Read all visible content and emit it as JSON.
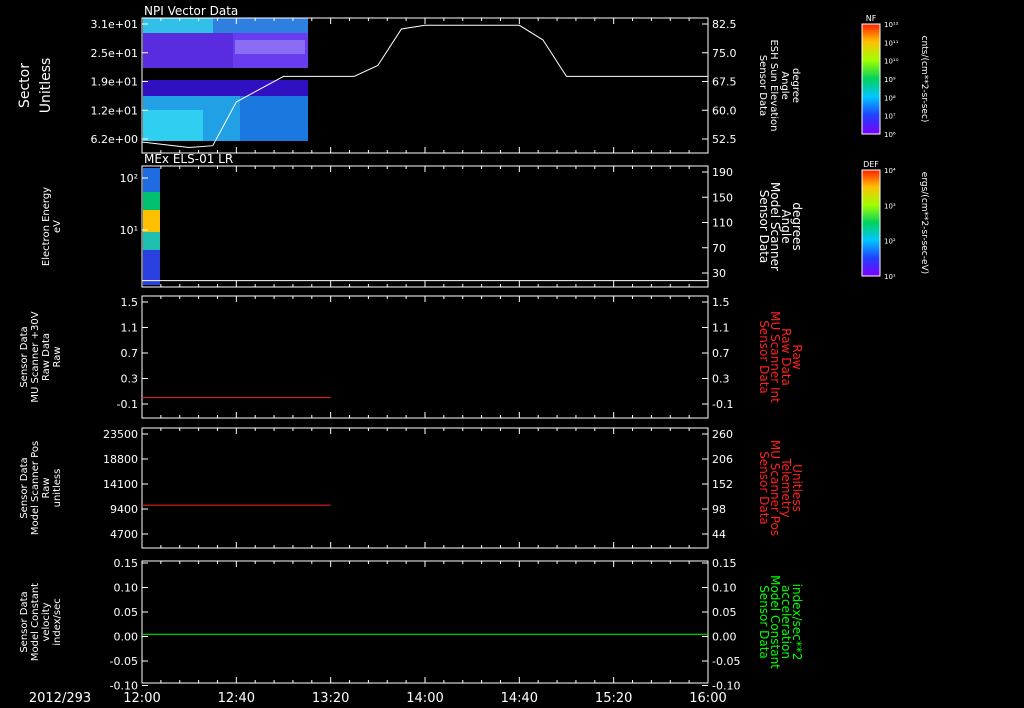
{
  "colors": {
    "white": "#ffffff",
    "red": "#ff2020",
    "green": "#00ff00",
    "frame": "#ffffff",
    "background": "#000000"
  },
  "time_axis": {
    "date": "2012/293",
    "ticks": [
      "12:00",
      "12:40",
      "13:20",
      "14:00",
      "14:40",
      "15:20",
      "16:00"
    ]
  },
  "panels": [
    {
      "title": "NPI Vector Data",
      "left_label": [
        "Sector",
        "Unitless"
      ],
      "left_ticks": [
        "3.1e+01",
        "2.5e+01",
        "1.9e+01",
        "1.2e+01",
        "6.2e+00"
      ],
      "right_label": [
        "Sensor Data",
        "ESH Sun Elevation",
        "Angle",
        "degree"
      ],
      "right_ticks": [
        "82.5",
        "75.0",
        "67.5",
        "60.0",
        "52.5"
      ],
      "colorbar": {
        "title": "NF",
        "unit": "cnts/(cm**2-sr-sec)",
        "ticks": [
          "10¹²",
          "10¹¹",
          "10¹⁰",
          "10⁹",
          "10⁸",
          "10⁷",
          "10⁶"
        ]
      }
    },
    {
      "title": "MEx ELS-01 LR",
      "left_label": [
        "Electron Energy",
        "eV"
      ],
      "left_ticks": [
        "10²",
        "10¹"
      ],
      "right_label": [
        "Sensor Data",
        "Model Scanner",
        "Angle",
        "degrees"
      ],
      "right_ticks": [
        "190",
        "150",
        "110",
        "70",
        "30"
      ],
      "colorbar": {
        "title": "DEF",
        "unit": "ergs/(cm**2-sr-sec-eV)",
        "ticks": [
          "10⁴",
          "10³",
          "10²",
          "10¹"
        ]
      }
    },
    {
      "title": "",
      "left_label": [
        "Sensor Data",
        "MU Scanner +30V",
        "Raw Data",
        "Raw"
      ],
      "left_ticks": [
        "1.5",
        "1.1",
        "0.7",
        "0.3",
        "-0.1"
      ],
      "right_label": [
        "Sensor Data",
        "MU Scanner Int",
        "Raw Data",
        "Raw"
      ],
      "right_ticks": [
        "1.5",
        "1.1",
        "0.7",
        "0.3",
        "-0.1"
      ]
    },
    {
      "title": "",
      "left_label": [
        "Sensor Data",
        "Model Scanner Pos",
        "Raw",
        "unitless"
      ],
      "left_ticks": [
        "23500",
        "18800",
        "14100",
        "9400",
        "4700"
      ],
      "right_label": [
        "Sensor Data",
        "MU Scanner Pos",
        "Telemetry",
        "Unitless"
      ],
      "right_ticks": [
        "260",
        "206",
        "152",
        "98",
        "44"
      ]
    },
    {
      "title": "",
      "left_label": [
        "Sensor Data",
        "Model Constant",
        "velocity",
        "index/sec"
      ],
      "left_ticks": [
        "0.15",
        "0.10",
        "0.05",
        "0.00",
        "-0.05",
        "-0.10"
      ],
      "right_label": [
        "Sensor Data",
        "Model Constant",
        "acceleration",
        "index/sec**2"
      ],
      "right_ticks": [
        "0.15",
        "0.10",
        "0.05",
        "0.00",
        "-0.05",
        "-0.10"
      ]
    }
  ],
  "chart_data": [
    {
      "type": "line",
      "title": "NPI Vector Data",
      "ylabel": "Sensor Data ESH Sun Elevation Angle degree",
      "x": [
        "12:00",
        "12:20",
        "12:30",
        "12:40",
        "13:00",
        "13:30",
        "13:40",
        "13:50",
        "14:00",
        "14:40",
        "14:50",
        "15:00",
        "15:20",
        "16:00"
      ],
      "values": [
        49,
        47.5,
        48,
        60,
        67,
        67,
        70,
        80,
        81,
        81,
        77,
        67,
        67,
        67
      ],
      "ylim": [
        46,
        83
      ]
    },
    {
      "type": "line",
      "title": "MEx ELS-01 LR",
      "ylabel": "Sensor Data Model Scanner Angle degrees",
      "x": [
        "12:00",
        "16:00"
      ],
      "values": [
        10,
        10
      ],
      "ylim": [
        0,
        190
      ]
    },
    {
      "type": "line",
      "ylabel": "Sensor Data MU Scanner +30V Raw Data Raw",
      "x": [
        "12:00",
        "13:20"
      ],
      "values": [
        0,
        0
      ],
      "ylim": [
        -0.3,
        1.5
      ]
    },
    {
      "type": "line",
      "ylabel": "Sensor Data Model Scanner Pos Raw unitless",
      "x": [
        "12:00",
        "13:20"
      ],
      "values": [
        8400,
        8400
      ],
      "ylim": [
        0,
        23500
      ]
    },
    {
      "type": "line",
      "ylabel": "Sensor Data Model Constant velocity index/sec",
      "x": [
        "12:00",
        "16:00"
      ],
      "values": [
        0,
        0
      ],
      "ylim": [
        -0.1,
        0.15
      ]
    }
  ]
}
